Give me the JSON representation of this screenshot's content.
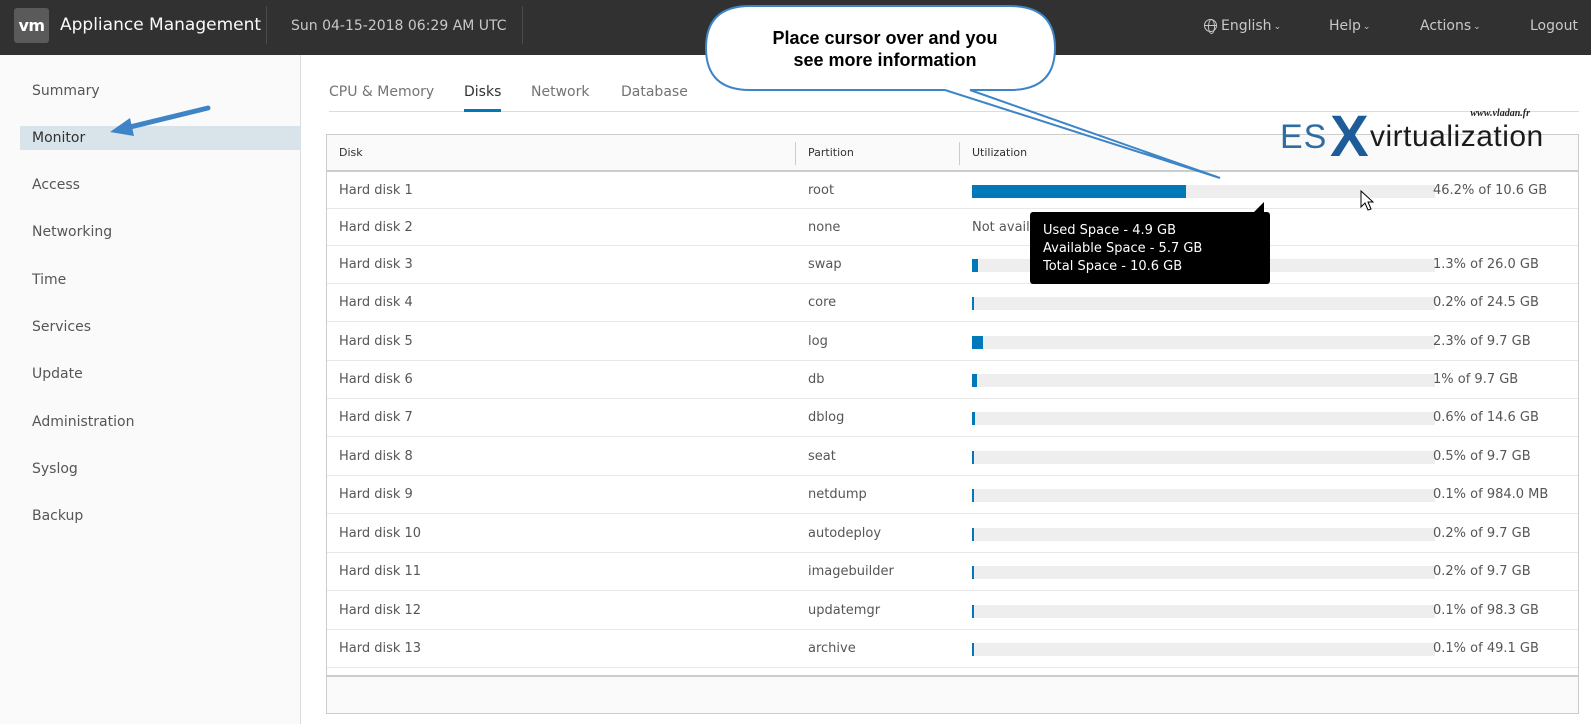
{
  "header": {
    "logo": "vm",
    "title": "Appliance Management",
    "datetime": "Sun 04-15-2018 06:29 AM UTC",
    "language": "English",
    "help": "Help",
    "actions": "Actions",
    "logout": "Logout"
  },
  "sidebar": {
    "items": [
      {
        "label": "Summary"
      },
      {
        "label": "Monitor",
        "active": true
      },
      {
        "label": "Access"
      },
      {
        "label": "Networking"
      },
      {
        "label": "Time"
      },
      {
        "label": "Services"
      },
      {
        "label": "Update"
      },
      {
        "label": "Administration"
      },
      {
        "label": "Syslog"
      },
      {
        "label": "Backup"
      }
    ]
  },
  "tabs": [
    {
      "label": "CPU & Memory"
    },
    {
      "label": "Disks",
      "active": true
    },
    {
      "label": "Network"
    },
    {
      "label": "Database"
    }
  ],
  "table": {
    "columns": [
      "Disk",
      "Partition",
      "Utilization"
    ],
    "rows": [
      {
        "disk": "Hard disk 1",
        "partition": "root",
        "utilization": 0.462,
        "label": "46.2% of 10.6 GB"
      },
      {
        "disk": "Hard disk 2",
        "partition": "none",
        "utilization": null,
        "label": "Not avail"
      },
      {
        "disk": "Hard disk 3",
        "partition": "swap",
        "utilization": 0.013,
        "label": "1.3% of 26.0 GB"
      },
      {
        "disk": "Hard disk 4",
        "partition": "core",
        "utilization": 0.002,
        "label": "0.2% of 24.5 GB"
      },
      {
        "disk": "Hard disk 5",
        "partition": "log",
        "utilization": 0.023,
        "label": "2.3% of 9.7 GB"
      },
      {
        "disk": "Hard disk 6",
        "partition": "db",
        "utilization": 0.01,
        "label": "1% of 9.7 GB"
      },
      {
        "disk": "Hard disk 7",
        "partition": "dblog",
        "utilization": 0.006,
        "label": "0.6% of 14.6 GB"
      },
      {
        "disk": "Hard disk 8",
        "partition": "seat",
        "utilization": 0.005,
        "label": "0.5% of 9.7 GB"
      },
      {
        "disk": "Hard disk 9",
        "partition": "netdump",
        "utilization": 0.001,
        "label": "0.1% of 984.0 MB"
      },
      {
        "disk": "Hard disk 10",
        "partition": "autodeploy",
        "utilization": 0.002,
        "label": "0.2% of 9.7 GB"
      },
      {
        "disk": "Hard disk 11",
        "partition": "imagebuilder",
        "utilization": 0.002,
        "label": "0.2% of 9.7 GB"
      },
      {
        "disk": "Hard disk 12",
        "partition": "updatemgr",
        "utilization": 0.001,
        "label": "0.1% of 98.3 GB"
      },
      {
        "disk": "Hard disk 13",
        "partition": "archive",
        "utilization": 0.001,
        "label": "0.1% of 49.1 GB"
      }
    ]
  },
  "tooltip": {
    "used": "Used Space - 4.9 GB",
    "available": "Available Space - 5.7 GB",
    "total": "Total Space - 10.6 GB"
  },
  "callout": {
    "line1": "Place cursor over and you",
    "line2": "see more information"
  },
  "watermark": {
    "url": "www.vladan.fr",
    "es": "ES",
    "x": "X",
    "rest": "virtualization"
  },
  "colors": {
    "header_bg": "#313131",
    "accent": "#0079b8",
    "active_sidebar": "#d9e4ea",
    "bar_track": "#eeeeee"
  }
}
